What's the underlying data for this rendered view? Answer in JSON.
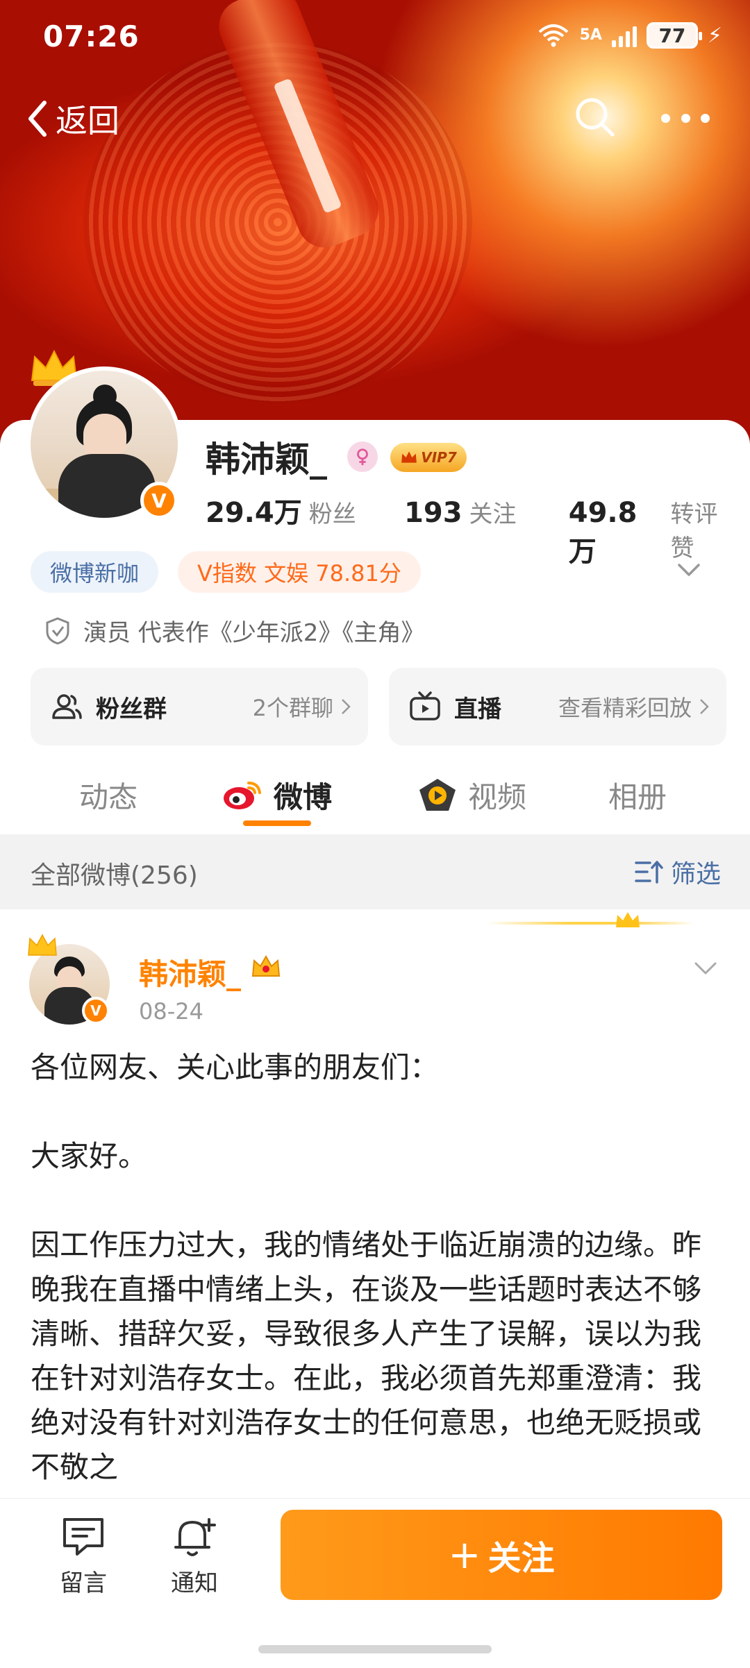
{
  "status_bar": {
    "time": "07:26",
    "network": "5A",
    "battery": "77"
  },
  "nav": {
    "back_label": "返回"
  },
  "profile": {
    "name": "韩沛颖_",
    "vip_label": "VIP7",
    "stats": [
      {
        "num": "29.4万",
        "label": "粉丝"
      },
      {
        "num": "193",
        "label": "关注"
      },
      {
        "num": "49.8万",
        "label": "转评赞"
      }
    ],
    "tags": {
      "new": "微博新咖",
      "vindex": "V指数 文娱 78.81分"
    },
    "occupation": "演员 代表作《少年派2》《主角》",
    "entries": {
      "fans": {
        "title": "粉丝群",
        "sub": "2个群聊"
      },
      "live": {
        "title": "直播",
        "sub": "查看精彩回放"
      }
    }
  },
  "tabs": [
    "动态",
    "微博",
    "视频",
    "相册"
  ],
  "filter": {
    "label": "全部微博(256)",
    "button": "筛选"
  },
  "post": {
    "author": "韩沛颖_",
    "date": "08-24",
    "paragraphs": [
      "各位网友、关心此事的朋友们：",
      "大家好。",
      "因工作压力过大，我的情绪处于临近崩溃的边缘。昨晚我在直播中情绪上头，在谈及一些话题时表达不够清晰、措辞欠妥，导致很多人产生了误解，误以为我在针对刘浩存女士。在此，我必须首先郑重澄清：我绝对没有针对刘浩存女士的任何意思，也绝无贬损或不敬之"
    ]
  },
  "bottom_bar": {
    "comment": "留言",
    "notify": "通知",
    "follow": "关注"
  },
  "colors": {
    "accent": "#ff8200",
    "link": "#4a6fa5",
    "vindex": "#ff6a1a"
  }
}
